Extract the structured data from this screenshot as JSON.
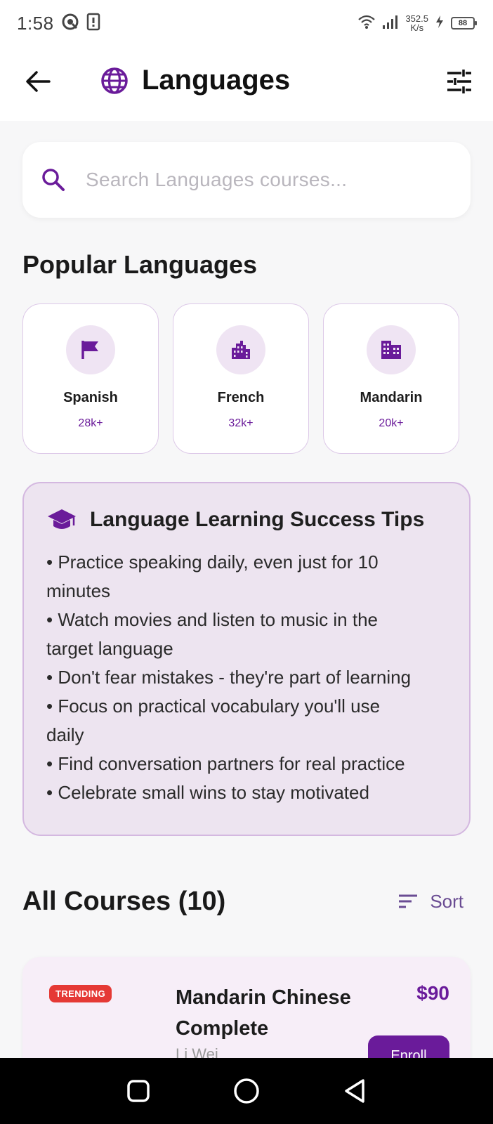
{
  "status_bar": {
    "time": "1:58",
    "net_speed_value": "352.5",
    "net_speed_unit": "K/s",
    "battery": "88"
  },
  "app_bar": {
    "title": "Languages",
    "icons": {
      "back": "arrow-left-icon",
      "title": "globe-icon",
      "filter": "tune-icon"
    }
  },
  "search": {
    "placeholder": "Search Languages courses...",
    "icon": "search-icon"
  },
  "popular": {
    "title": "Popular Languages",
    "items": [
      {
        "name": "Spanish",
        "count": "28k+",
        "icon": "flag-icon"
      },
      {
        "name": "French",
        "count": "32k+",
        "icon": "city-icon"
      },
      {
        "name": "Mandarin",
        "count": "20k+",
        "icon": "building-icon"
      }
    ]
  },
  "tips": {
    "title": "Language Learning Success Tips",
    "icon": "graduation-cap-icon",
    "lines": [
      "• Practice speaking daily, even just for 10",
      "minutes",
      "• Watch movies and listen to music in the",
      "target language",
      "• Don't fear mistakes - they're part of learning",
      "• Focus on practical vocabulary you'll use",
      "daily",
      "• Find conversation partners for real practice",
      "• Celebrate small wins to stay motivated"
    ]
  },
  "courses": {
    "title": "All Courses (10)",
    "sort_label": "Sort",
    "items": [
      {
        "badge": "TRENDING",
        "title_line1": "Mandarin Chinese",
        "title_line2": "Complete",
        "price": "$90",
        "instructor": "Li Wei",
        "enroll_label": "Enroll"
      }
    ]
  },
  "colors": {
    "accent": "#6a1b9a",
    "tips_bg": "#ede4f0",
    "badge_red": "#e53935"
  }
}
